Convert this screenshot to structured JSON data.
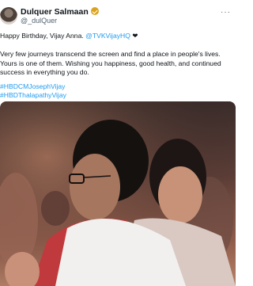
{
  "author": {
    "name": "Dulquer Salmaan",
    "handle": "@_dulQuer",
    "more_icon": "more-horizontal-icon",
    "verified_color": "#d9a31f"
  },
  "tweet": {
    "greeting": "Happy Birthday, Vijay Anna.",
    "mention": "@TVKVijayHQ",
    "heart": "❤",
    "body": "Very few journeys transcend the screen and find a place in people's lives. Yours is one of them. Wishing you happiness, good health, and continued success in everything you do.",
    "hashtag_1": "#HBDCMJosephVijay",
    "hashtag_2": "#HBDThalapathyVijay"
  },
  "colors": {
    "link": "#1d9bf0",
    "text": "#0f1419",
    "secondary": "#536471"
  }
}
